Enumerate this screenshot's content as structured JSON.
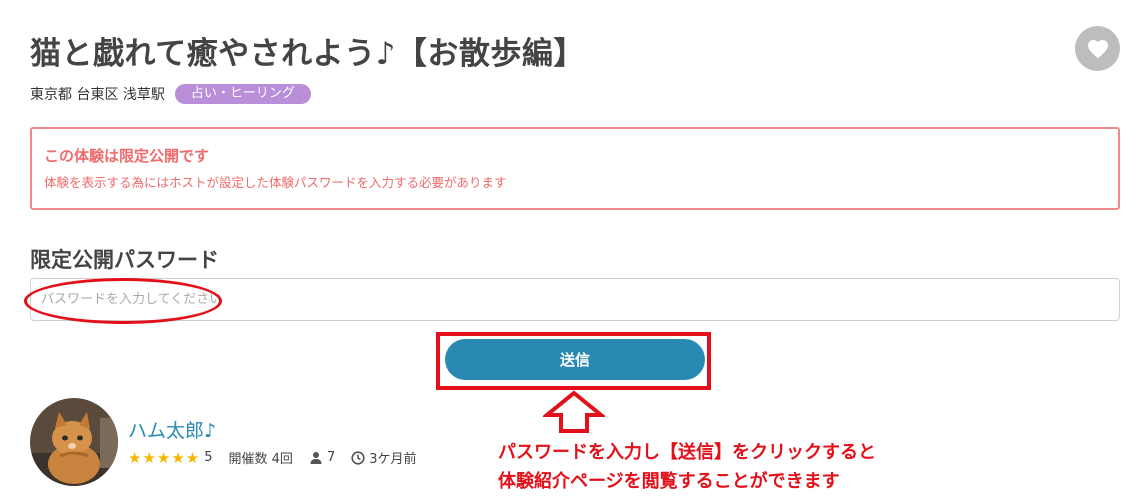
{
  "experience": {
    "title": "猫と戯れて癒やされよう♪【お散歩編】",
    "location": "東京都 台東区 浅草駅",
    "category_tag": "占い・ヒーリング"
  },
  "notice": {
    "title": "この体験は限定公開です",
    "body": "体験を表示する為にはホストが設定した体験パスワードを入力する必要があります"
  },
  "password_form": {
    "label": "限定公開パスワード",
    "placeholder": "パスワードを入力してください",
    "value": "",
    "submit_label": "送信"
  },
  "annotation": {
    "line1": "パスワードを入力し【送信】をクリックすると",
    "line2": "体験紹介ページを閲覧することができます",
    "color": "#e3101a"
  },
  "host": {
    "name": "ハム太郎♪",
    "stars": "★★★★★",
    "rating": "5",
    "sessions": "開催数 4回",
    "followers": "7",
    "last_active": "3ケ月前"
  },
  "icons": {
    "favorite": "heart-icon",
    "followers": "person-icon",
    "time": "clock-icon"
  },
  "colors": {
    "accent": "#2a89b3",
    "tag": "#b98fd9",
    "notice": "#ef6b6b",
    "star": "#f7b500"
  }
}
